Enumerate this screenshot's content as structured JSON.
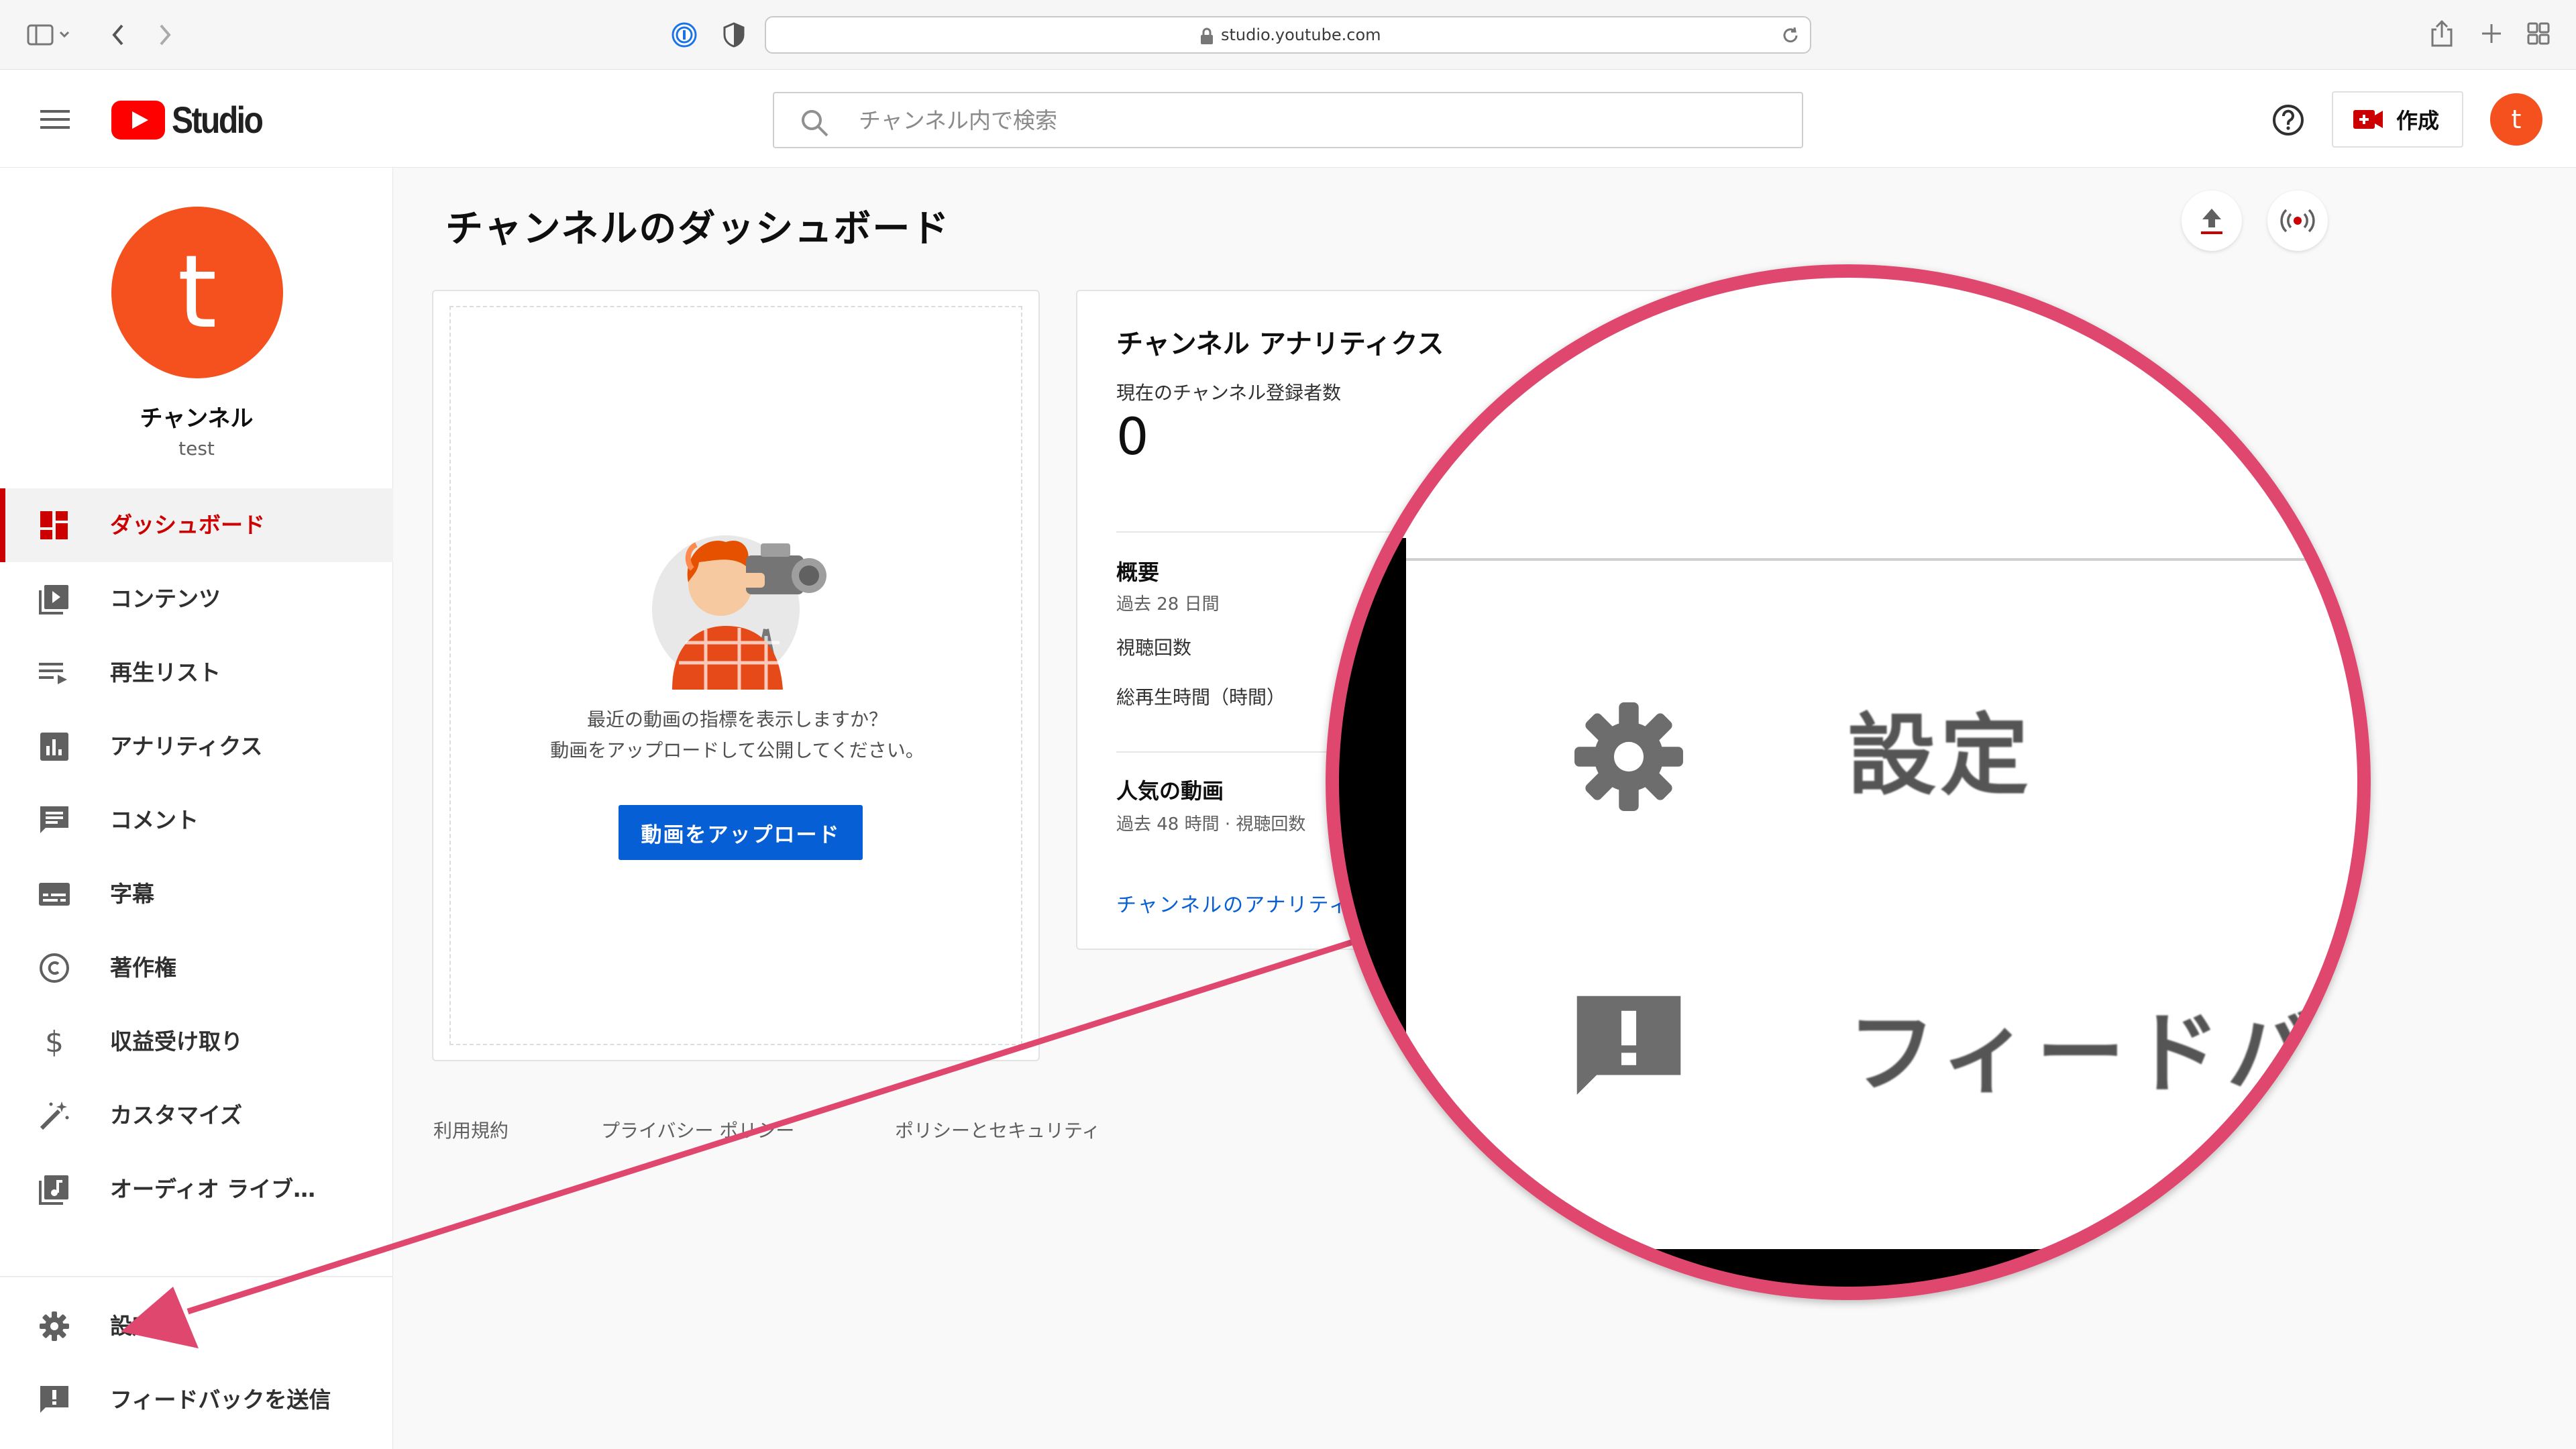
{
  "browser": {
    "url": "studio.youtube.com"
  },
  "header": {
    "logo_text": "Studio",
    "search_placeholder": "チャンネル内で検索",
    "create_label": "作成",
    "avatar_letter": "t"
  },
  "sidebar": {
    "avatar_letter": "t",
    "channel_name": "チャンネル",
    "channel_handle": "test",
    "items": [
      {
        "label": "ダッシュボード",
        "icon": "dashboard-icon",
        "active": true
      },
      {
        "label": "コンテンツ",
        "icon": "video-library-icon"
      },
      {
        "label": "再生リスト",
        "icon": "playlist-icon"
      },
      {
        "label": "アナリティクス",
        "icon": "analytics-icon"
      },
      {
        "label": "コメント",
        "icon": "comment-icon"
      },
      {
        "label": "字幕",
        "icon": "subtitles-icon"
      },
      {
        "label": "著作権",
        "icon": "copyright-icon"
      },
      {
        "label": "収益受け取り",
        "icon": "dollar-icon"
      },
      {
        "label": "カスタマイズ",
        "icon": "magic-wand-icon"
      },
      {
        "label": "オーディオ ライブ…",
        "icon": "audio-library-icon"
      }
    ],
    "bottom_items": [
      {
        "label": "設定",
        "icon": "gear-icon"
      },
      {
        "label": "フィードバックを送信",
        "icon": "feedback-icon"
      }
    ]
  },
  "main": {
    "title": "チャンネルのダッシュボード",
    "upload_card": {
      "text_line1": "最近の動画の指標を表示しますか？",
      "text_line2": "動画をアップロードして公開してください。",
      "button_label": "動画をアップロード"
    },
    "analytics": {
      "title": "チャンネル アナリティクス",
      "subscribers_label": "現在のチャンネル登録者数",
      "subscribers_count": "0",
      "summary_title": "概要",
      "summary_period": "過去 28 日間",
      "views_label": "視聴回数",
      "watch_time_label": "総再生時間（時間）",
      "popular_title": "人気の動画",
      "popular_period": "過去 48 時間 · 視聴回数",
      "link_label": "チャンネルのアナリティ"
    },
    "footer": {
      "terms": "利用規約",
      "privacy": "プライバシー ポリシー",
      "policy": "ポリシーとセキュリティ"
    }
  },
  "magnifier": {
    "settings_label": "設定",
    "feedback_label": "フィードバ",
    "ring_color": "#e0476f"
  },
  "colors": {
    "youtube_red": "#ff0000",
    "active_red": "#cc0000",
    "avatar_orange": "#f4511e",
    "button_blue": "#065fd4"
  }
}
